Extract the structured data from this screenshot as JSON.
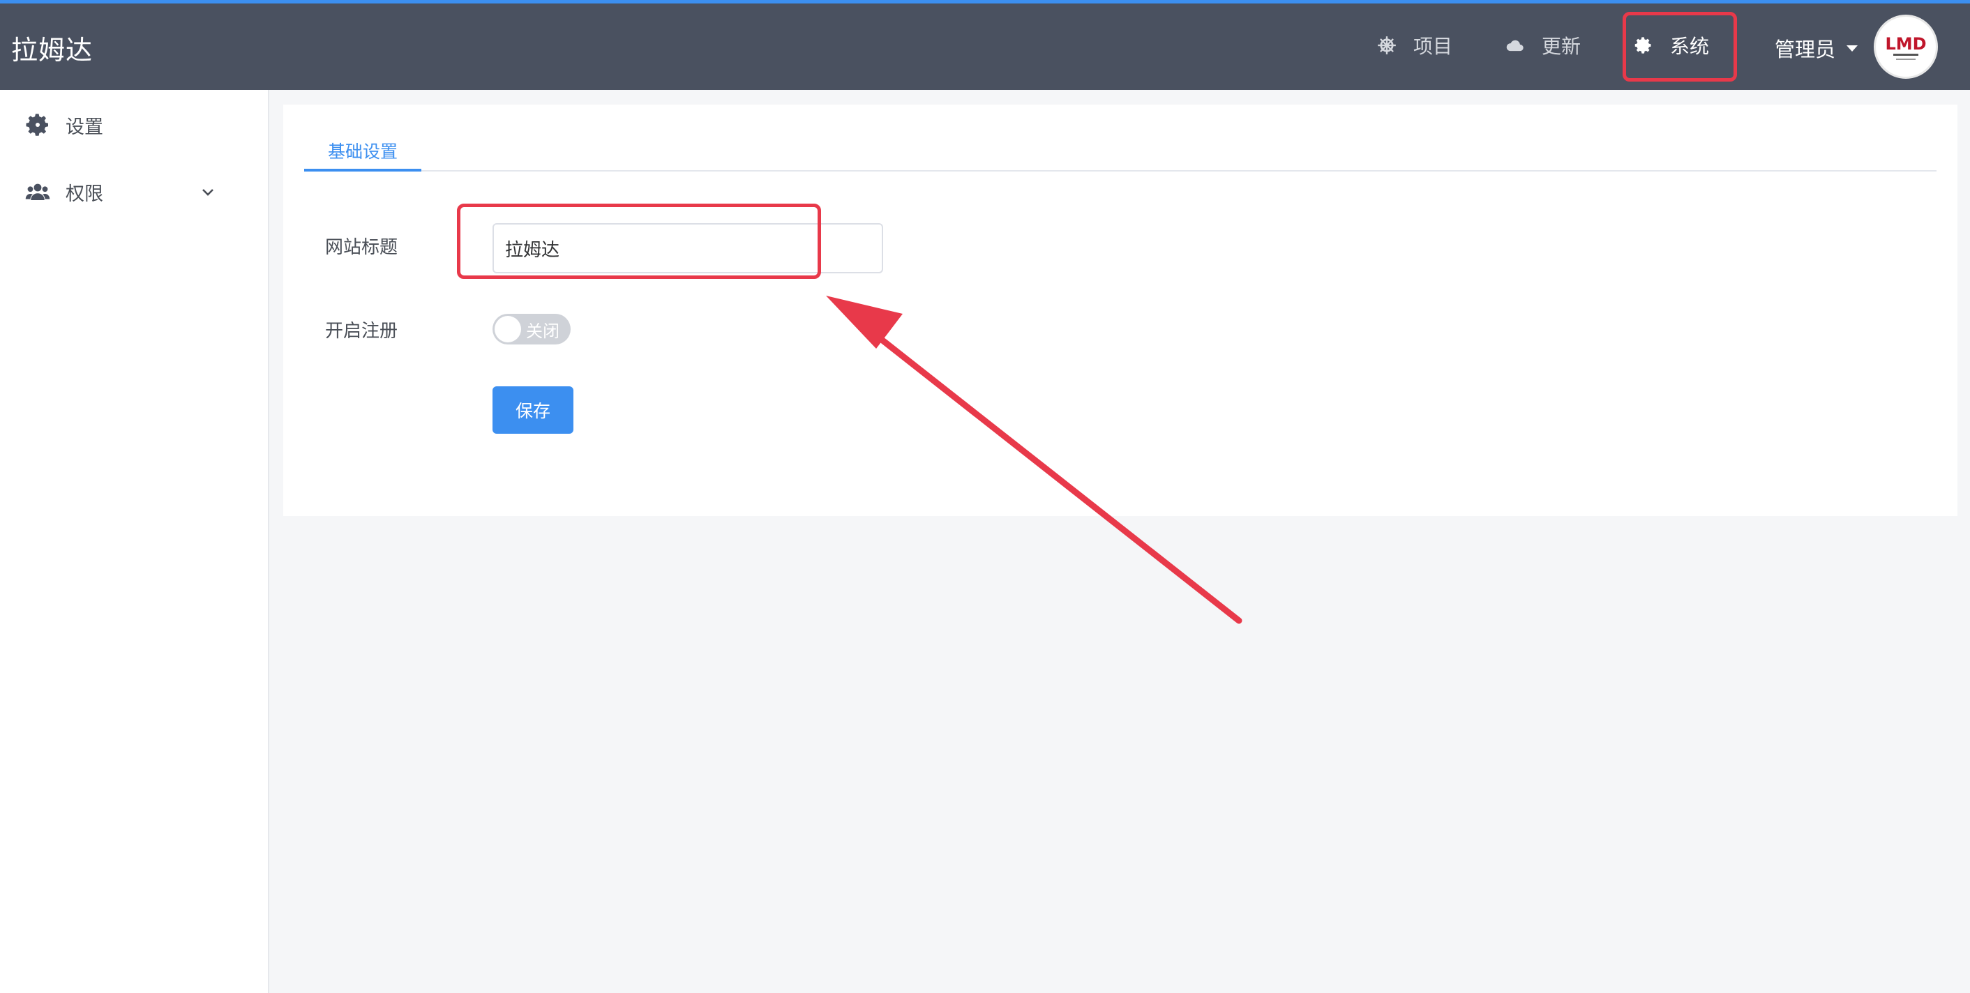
{
  "header": {
    "brand": "拉姆达",
    "nav": {
      "project": "项目",
      "update": "更新",
      "system": "系统"
    },
    "user": "管理员",
    "avatar_text": "LMD"
  },
  "sidebar": {
    "items": [
      {
        "label": "设置"
      },
      {
        "label": "权限"
      }
    ]
  },
  "main": {
    "tabs": [
      {
        "label": "基础设置"
      }
    ],
    "form": {
      "site_title_label": "网站标题",
      "site_title_value": "拉姆达",
      "register_label": "开启注册",
      "register_switch_text": "关闭",
      "register_enabled": false,
      "save_label": "保存"
    }
  },
  "colors": {
    "header_bg": "#4a5160",
    "accent": "#3c8ff0",
    "annotation": "#e8394a"
  }
}
